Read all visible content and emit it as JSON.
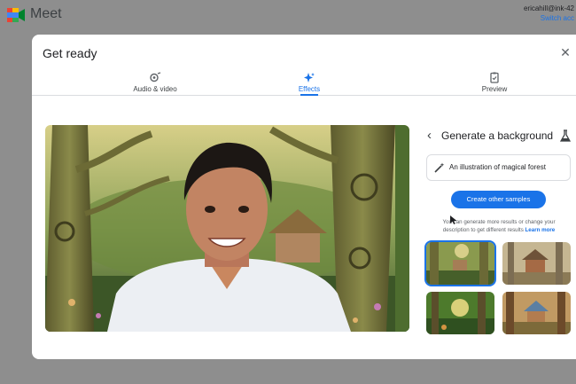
{
  "app": {
    "name": "Meet"
  },
  "account": {
    "email": "ericahill@ink-42",
    "switch_label": "Switch acc"
  },
  "dialog": {
    "title": "Get ready",
    "tabs": [
      {
        "label": "Audio & video",
        "icon": "audio-video-icon"
      },
      {
        "label": "Effects",
        "icon": "sparkle-icon",
        "active": true
      },
      {
        "label": "Preview",
        "icon": "preview-icon"
      }
    ]
  },
  "panel": {
    "title": "Generate a background",
    "prompt_text": "An illustration of magical forest",
    "cta_label": "Create other samples",
    "help_text": "You can generate more results or change your description to get different results",
    "learn_more": "Learn more"
  },
  "colors": {
    "accent": "#1a73e8",
    "backdrop": "#8e8e8e"
  }
}
